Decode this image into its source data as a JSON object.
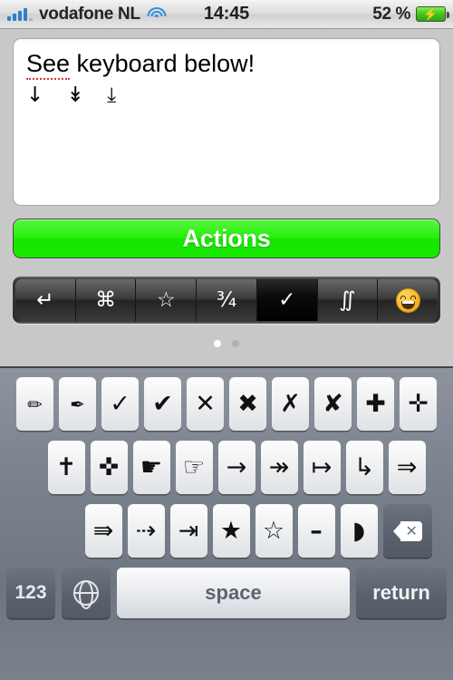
{
  "status_bar": {
    "carrier": "vodafone NL",
    "signal_icon": "cellular-signal-icon",
    "wifi_icon": "wifi-icon",
    "time": "14:45",
    "battery_percent": "52 %",
    "battery_icon": "battery-charging-icon",
    "signal_bars_filled": 4,
    "signal_bars_total": 5
  },
  "text_area": {
    "line1_misspelled": "See",
    "line1_rest": " keyboard below!",
    "line2_symbols": "↓ ↡ ⤓",
    "placeholder": ""
  },
  "actions_button": {
    "label": "Actions",
    "color": "#1fe806"
  },
  "segmented_control": {
    "selected_index": 4,
    "segments": [
      {
        "glyph": "↵",
        "name": "carriage-return-symbol"
      },
      {
        "glyph": "⌘",
        "name": "command-symbol"
      },
      {
        "glyph": "☆",
        "name": "star-outline-symbol"
      },
      {
        "glyph": "¾",
        "name": "three-quarters-fraction-symbol"
      },
      {
        "glyph": "✓",
        "name": "checkmark-symbol"
      },
      {
        "glyph": "∬",
        "name": "double-integral-symbol"
      },
      {
        "glyph": "emoji",
        "name": "grinning-face-emoji"
      }
    ]
  },
  "page_dots": {
    "count": 2,
    "active_index": 0
  },
  "keyboard": {
    "row1": [
      {
        "glyph": "✏",
        "name": "pencil-key",
        "size": "small"
      },
      {
        "glyph": "✒",
        "name": "pen-nib-key",
        "size": "small"
      },
      {
        "glyph": "✓",
        "name": "check-mark-key",
        "size": "big"
      },
      {
        "glyph": "✔",
        "name": "heavy-check-mark-key",
        "size": "big"
      },
      {
        "glyph": "✕",
        "name": "multiplication-x-key",
        "size": "big"
      },
      {
        "glyph": "✖",
        "name": "heavy-multiplication-x-key",
        "size": "big"
      },
      {
        "glyph": "✗",
        "name": "ballot-x-key",
        "size": "big"
      },
      {
        "glyph": "✘",
        "name": "heavy-ballot-x-key",
        "size": "big"
      },
      {
        "glyph": "✚",
        "name": "heavy-greek-cross-key",
        "size": "big"
      },
      {
        "glyph": "✛",
        "name": "open-centre-cross-key",
        "size": "big"
      }
    ],
    "row2": [
      {
        "glyph": "✝",
        "name": "latin-cross-key",
        "size": "big"
      },
      {
        "glyph": "✜",
        "name": "heavy-open-centre-cross-key",
        "size": "big"
      },
      {
        "glyph": "☛",
        "name": "black-right-pointing-index-key",
        "size": "big"
      },
      {
        "glyph": "☞",
        "name": "white-right-pointing-index-key",
        "size": "big"
      },
      {
        "glyph": "→",
        "name": "rightwards-arrow-key",
        "size": "big"
      },
      {
        "glyph": "↠",
        "name": "rightwards-two-headed-arrow-key",
        "size": "big"
      },
      {
        "glyph": "↦",
        "name": "rightwards-arrow-from-bar-key",
        "size": "big"
      },
      {
        "glyph": "↳",
        "name": "downwards-arrow-with-tip-rightwards-key",
        "size": "big"
      },
      {
        "glyph": "⇒",
        "name": "rightwards-double-arrow-key",
        "size": "big"
      }
    ],
    "row3": [
      {
        "glyph": "⇛",
        "name": "rightwards-triple-arrow-key",
        "size": "big"
      },
      {
        "glyph": "⇢",
        "name": "rightwards-dashed-arrow-key",
        "size": "big"
      },
      {
        "glyph": "⇥",
        "name": "rightwards-arrow-to-bar-key",
        "size": "big"
      },
      {
        "glyph": "★",
        "name": "black-star-key",
        "size": "big"
      },
      {
        "glyph": "☆",
        "name": "white-star-key",
        "size": "big"
      },
      {
        "glyph": "–",
        "name": "en-dash-key",
        "size": "big"
      },
      {
        "glyph": "◗",
        "name": "right-half-black-circle-key",
        "size": "big"
      }
    ],
    "delete_key": {
      "name": "delete-key",
      "glyph": "⌫"
    },
    "bottom_row": {
      "numbers_label": "123",
      "globe_icon": "globe-key",
      "space_label": "space",
      "return_label": "return"
    }
  }
}
